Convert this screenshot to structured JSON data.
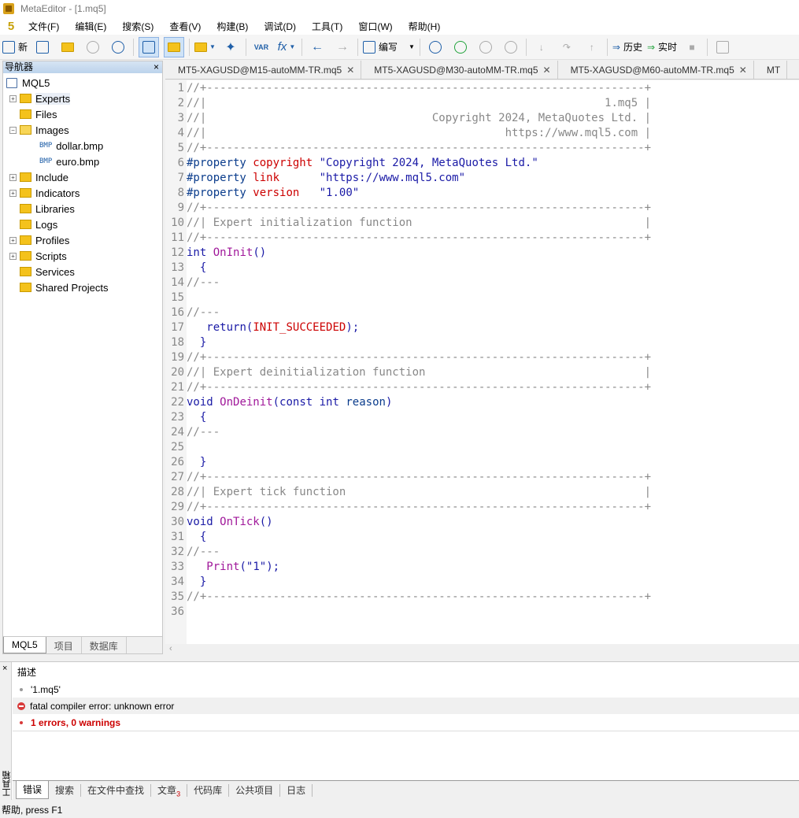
{
  "window": {
    "title": "MetaEditor - [1.mq5]"
  },
  "menu": [
    "文件(F)",
    "编辑(E)",
    "搜索(S)",
    "查看(V)",
    "构建(B)",
    "调试(D)",
    "工具(T)",
    "窗口(W)",
    "帮助(H)"
  ],
  "toolbar": {
    "new_label": "新",
    "compile_label": "编写",
    "history_label": "历史",
    "realtime_label": "实时",
    "var_label": "VAR",
    "fx_label": "fx"
  },
  "navigator": {
    "title": "导航器",
    "root": "MQL5",
    "items": [
      "Experts",
      "Files",
      "Images",
      "dollar.bmp",
      "euro.bmp",
      "Include",
      "Indicators",
      "Libraries",
      "Logs",
      "Profiles",
      "Scripts",
      "Services",
      "Shared Projects"
    ],
    "bmp_tag": "BMP",
    "tabs": [
      "MQL5",
      "项目",
      "数据库"
    ]
  },
  "editor_tabs": [
    "MT5-XAGUSD@M15-autoMM-TR.mq5",
    "MT5-XAGUSD@M30-autoMM-TR.mq5",
    "MT5-XAGUSD@M60-autoMM-TR.mq5",
    "MT"
  ],
  "code": {
    "lines": [
      "1",
      "2",
      "3",
      "4",
      "5",
      "6",
      "7",
      "8",
      "9",
      "10",
      "11",
      "12",
      "13",
      "14",
      "15",
      "16",
      "17",
      "18",
      "19",
      "20",
      "21",
      "22",
      "23",
      "24",
      "25",
      "26",
      "27",
      "28",
      "29",
      "30",
      "31",
      "32",
      "33",
      "34",
      "35",
      "36"
    ],
    "sep": "//+------------------------------------------------------------------+",
    "hdr2": "//|                                                            1.mq5 |",
    "hdr3": "//|                                  Copyright 2024, MetaQuotes Ltd. |",
    "hdr4": "//|                                             https://www.mql5.com |",
    "prop": "#property",
    "copyright_kw": "copyright",
    "copyright_val": "\"Copyright 2024, MetaQuotes Ltd.\"",
    "link_kw": "link",
    "link_val": "\"https://www.mql5.com\"",
    "version_kw": "version",
    "version_val": "\"1.00\"",
    "init_cmt": "//| Expert initialization function                                   |",
    "deinit_cmt": "//| Expert deinitialization function                                 |",
    "tick_cmt": "//| Expert tick function                                             |",
    "int_kw": "int",
    "void_kw": "void",
    "oninit": "OnInit",
    "ondeinit": "OnDeinit",
    "ontick": "OnTick",
    "const_kw": "const",
    "reason": "reason",
    "brace_open": "{",
    "brace_close": "}",
    "dashes": "//---",
    "return_kw": "return",
    "init_succeeded": "INIT_SUCCEEDED",
    "print_fn": "Print",
    "print_arg": "\"1\""
  },
  "toolbox": {
    "side_label": "工具箱",
    "header": "描述",
    "rows": [
      "'1.mq5'",
      "fatal compiler error: unknown error",
      "1 errors, 0 warnings"
    ],
    "tabs": [
      "错误",
      "搜索",
      "在文件中查找",
      "文章",
      "代码库",
      "公共项目",
      "日志"
    ],
    "article_count": "3"
  },
  "status": "帮助, press F1",
  "colors": {
    "keyword": "#1a1aa6",
    "function": "#a0189a",
    "comment": "#888888",
    "error": "#cc0000"
  }
}
